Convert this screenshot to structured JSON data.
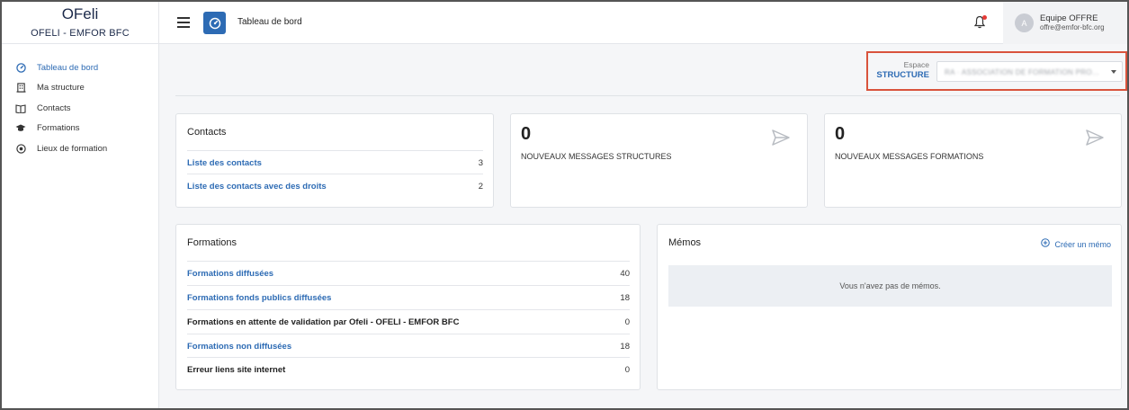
{
  "brand": {
    "title": "OFeli",
    "subtitle": "OFELI - EMFOR BFC"
  },
  "sidebar": {
    "items": [
      {
        "label": "Tableau de bord",
        "icon": "dashboard-icon",
        "active": true
      },
      {
        "label": "Ma structure",
        "icon": "building-icon",
        "active": false
      },
      {
        "label": "Contacts",
        "icon": "contacts-book-icon",
        "active": false
      },
      {
        "label": "Formations",
        "icon": "graduation-cap-icon",
        "active": false
      },
      {
        "label": "Lieux de formation",
        "icon": "location-target-icon",
        "active": false
      }
    ]
  },
  "header": {
    "title": "Tableau de bord",
    "user": {
      "initial": "A",
      "name": "Equipe OFFRE",
      "email": "offre@emfor-bfc.org"
    }
  },
  "espace": {
    "label": "Espace",
    "value": "STRUCTURE"
  },
  "contacts_card": {
    "title": "Contacts",
    "rows": [
      {
        "label": "Liste des contacts",
        "value": "3"
      },
      {
        "label": "Liste des contacts avec des droits",
        "value": "2"
      }
    ]
  },
  "messages_structures": {
    "count": "0",
    "label": "NOUVEAUX MESSAGES STRUCTURES"
  },
  "messages_formations": {
    "count": "0",
    "label": "NOUVEAUX MESSAGES FORMATIONS"
  },
  "formations_card": {
    "title": "Formations",
    "rows": [
      {
        "label": "Formations diffusées",
        "value": "40"
      },
      {
        "label": "Formations fonds publics diffusées",
        "value": "18"
      },
      {
        "label": "Formations en attente de validation par Ofeli - OFELI - EMFOR BFC",
        "value": "0"
      },
      {
        "label": "Formations non diffusées",
        "value": "18"
      },
      {
        "label": "Erreur liens site internet",
        "value": "0"
      }
    ]
  },
  "memos_card": {
    "title": "Mémos",
    "create_label": "Créer un mémo",
    "empty_text": "Vous n'avez pas de mémos."
  },
  "colors": {
    "accent": "#2d6bb4",
    "highlight_border": "#d9533c",
    "notification": "#e53935"
  }
}
